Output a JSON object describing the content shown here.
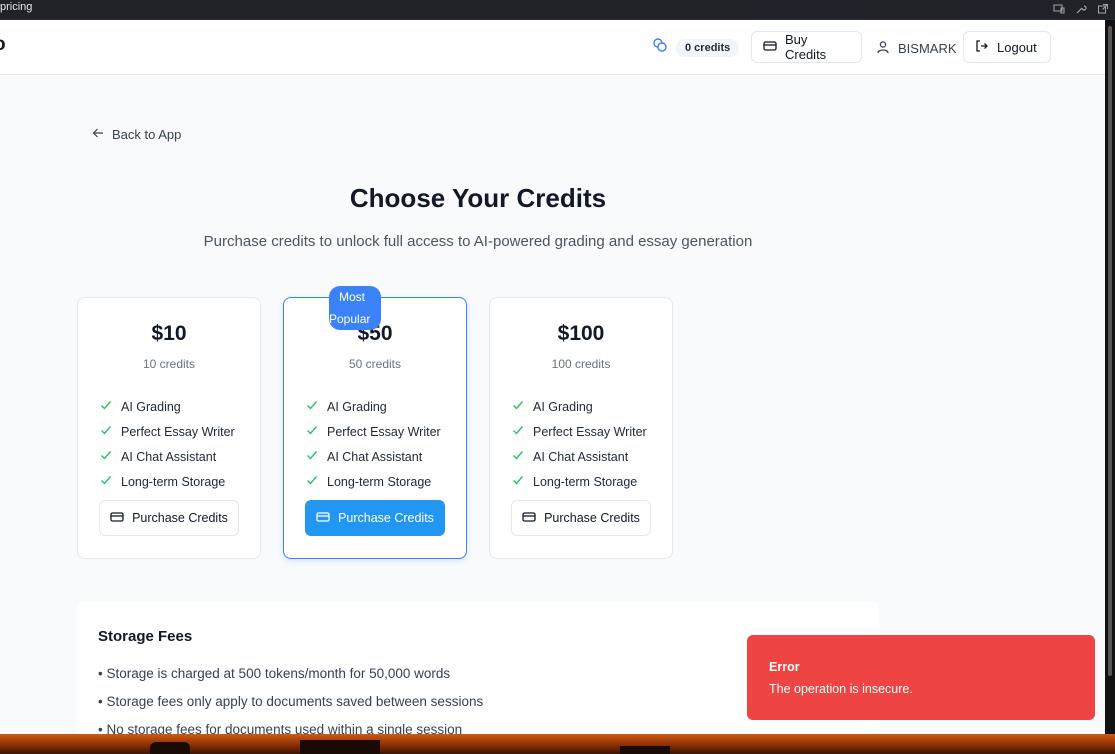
{
  "browser": {
    "url_fragment": "pricing"
  },
  "header": {
    "logo_fragment": "o",
    "credits": "0 credits",
    "buy_label": "Buy Credits",
    "user": "BISMARK",
    "logout_label": "Logout"
  },
  "back_label": "Back to App",
  "title": "Choose Your Credits",
  "subtitle": "Purchase credits to unlock full access to AI-powered grading and essay generation",
  "popular_badge": {
    "line1": "Most",
    "line2": "Popular"
  },
  "plans": [
    {
      "price": "$10",
      "credits": "10 credits",
      "features": [
        "AI Grading",
        "Perfect Essay Writer",
        "AI Chat Assistant",
        "Long-term Storage"
      ],
      "button": "Purchase Credits"
    },
    {
      "price": "$50",
      "credits": "50 credits",
      "features": [
        "AI Grading",
        "Perfect Essay Writer",
        "AI Chat Assistant",
        "Long-term Storage"
      ],
      "button": "Purchase Credits"
    },
    {
      "price": "$100",
      "credits": "100 credits",
      "features": [
        "AI Grading",
        "Perfect Essay Writer",
        "AI Chat Assistant",
        "Long-term Storage"
      ],
      "button": "Purchase Credits"
    }
  ],
  "storage": {
    "title": "Storage Fees",
    "lines": [
      "• Storage is charged at 500 tokens/month for 50,000 words",
      "• Storage fees only apply to documents saved between sessions",
      "• No storage fees for documents used within a single session"
    ]
  },
  "toast": {
    "title": "Error",
    "message": "The operation is insecure."
  },
  "colors": {
    "accent": "#2196f3",
    "badge": "#3b82f6",
    "check": "#22c55e",
    "error": "#ef4444"
  }
}
